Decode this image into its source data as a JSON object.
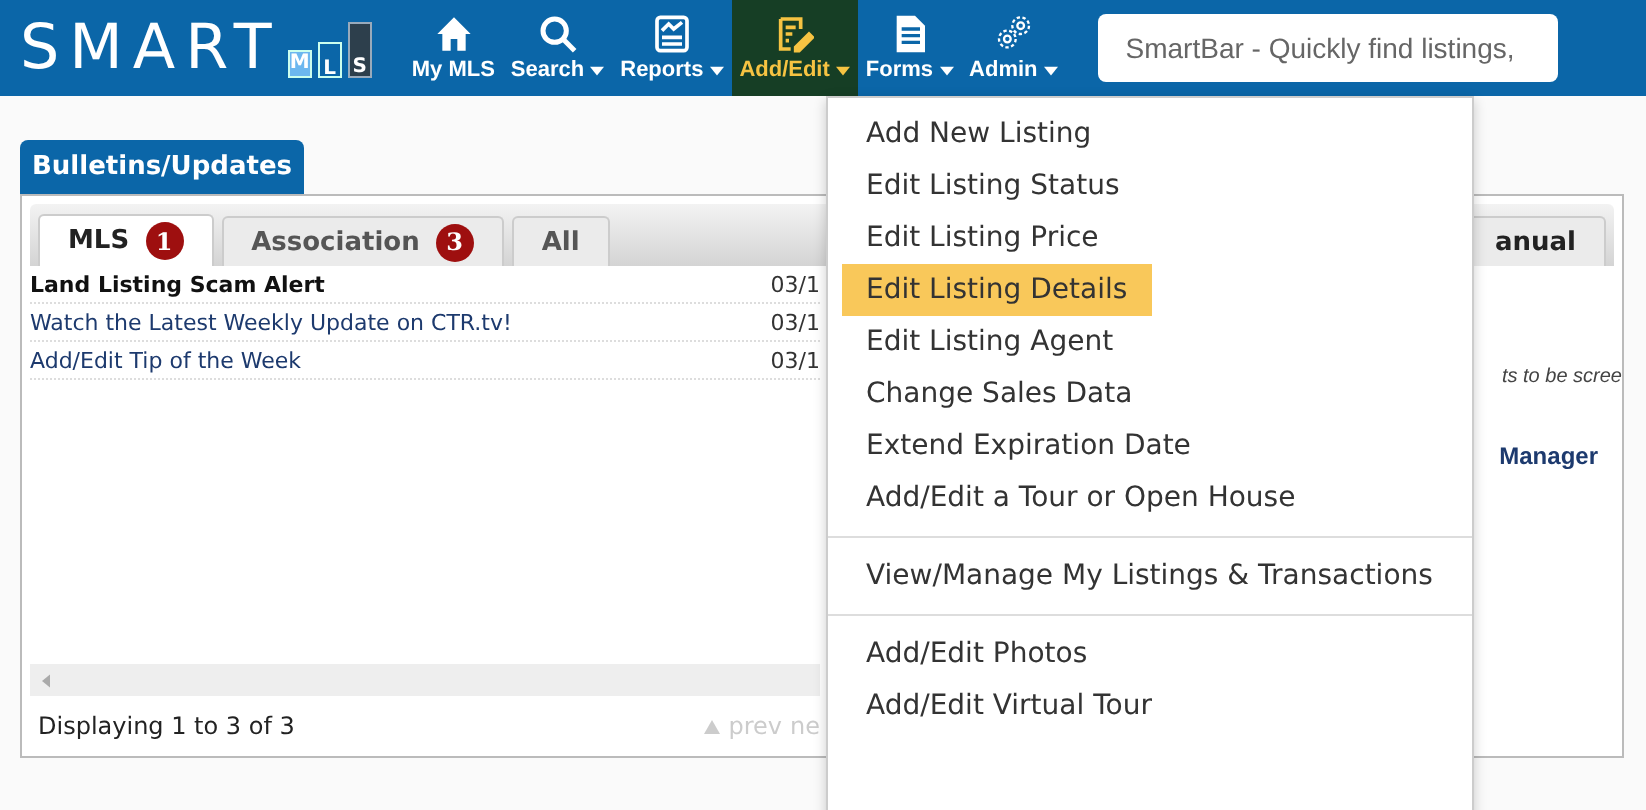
{
  "header": {
    "logo": {
      "word": "SMART",
      "letters": [
        "M",
        "L",
        "S"
      ]
    },
    "nav": [
      {
        "label": "My MLS",
        "kind": "home",
        "caret": false,
        "selected": false
      },
      {
        "label": "Search",
        "kind": "search",
        "caret": true,
        "selected": false
      },
      {
        "label": "Reports",
        "kind": "reports",
        "caret": true,
        "selected": false
      },
      {
        "label": "Add/Edit",
        "kind": "edit",
        "caret": true,
        "selected": true
      },
      {
        "label": "Forms",
        "kind": "forms",
        "caret": true,
        "selected": false
      },
      {
        "label": "Admin",
        "kind": "gears",
        "caret": true,
        "selected": false
      }
    ],
    "smartbar": {
      "placeholder": "SmartBar - Quickly find listings,"
    }
  },
  "dropdown": {
    "groups": [
      [
        {
          "label": "Add New Listing",
          "selected": false
        },
        {
          "label": "Edit Listing Status",
          "selected": false
        },
        {
          "label": "Edit Listing Price",
          "selected": false
        },
        {
          "label": "Edit Listing Details",
          "selected": true
        },
        {
          "label": "Edit Listing Agent",
          "selected": false
        },
        {
          "label": "Change Sales Data",
          "selected": false
        },
        {
          "label": "Extend Expiration Date",
          "selected": false
        },
        {
          "label": "Add/Edit a Tour or Open House",
          "selected": false
        }
      ],
      [
        {
          "label": "View/Manage My Listings & Transactions",
          "selected": false
        }
      ],
      [
        {
          "label": "Add/Edit Photos",
          "selected": false
        },
        {
          "label": "Add/Edit Virtual Tour",
          "selected": false
        }
      ]
    ]
  },
  "panel": {
    "title": "Bulletins/Updates",
    "tabs": [
      {
        "label": "MLS",
        "badge": "1",
        "selected": true
      },
      {
        "label": "Association",
        "badge": "3",
        "selected": false
      },
      {
        "label": "All",
        "selected": false
      }
    ],
    "right_tab": "anual",
    "rows": [
      {
        "title": "Land Listing Scam Alert",
        "date": "03/1",
        "bold": true
      },
      {
        "title": "Watch the Latest Weekly Update on CTR.tv!",
        "date": "03/1",
        "bold": false
      },
      {
        "title": "Add/Edit Tip of the Week",
        "date": "03/1",
        "bold": false
      }
    ],
    "footer": "Displaying 1 to 3 of 3",
    "pager": {
      "prev": "prev",
      "next": "ne"
    }
  },
  "side": {
    "note": "ts to be scree",
    "heading": "Manager"
  }
}
